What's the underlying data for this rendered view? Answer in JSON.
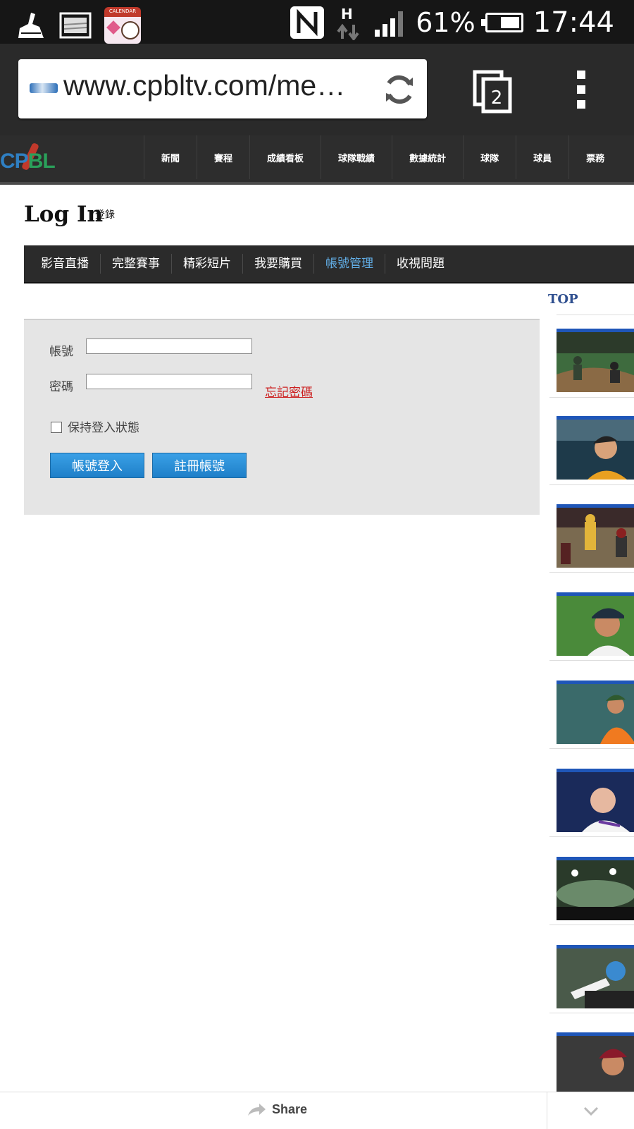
{
  "status_bar": {
    "battery_percent": "61%",
    "battery_level": 0.61,
    "time": "17:44",
    "network_type": "H",
    "calendar_app_label": "CALENDAR"
  },
  "browser": {
    "url": "www.cpbltv.com/membe…",
    "tab_count": "2"
  },
  "site_header": {
    "logo_left": "CP",
    "logo_right": "BL",
    "nav": [
      "新聞",
      "賽程",
      "成績看板",
      "球隊戰績",
      "數據統計",
      "球隊",
      "球員",
      "票務"
    ]
  },
  "page": {
    "title": "Log In",
    "subtitle": "登錄"
  },
  "subnav": {
    "items": [
      "影音直播",
      "完整賽事",
      "精彩短片",
      "我要購買",
      "帳號管理",
      "收視問題"
    ],
    "active_index": 4
  },
  "login": {
    "account_label": "帳號",
    "account_value": "",
    "password_label": "密碼",
    "password_value": "",
    "forgot_password": "忘記密碼",
    "remember_label": "保持登入狀態",
    "remember_checked": false,
    "login_button": "帳號登入",
    "register_button": "註冊帳號"
  },
  "sidebar": {
    "title": "TOP",
    "thumbnails": 9
  },
  "share_bar": {
    "share_label": "Share"
  },
  "colors": {
    "accent_blue": "#1e7fc8",
    "active_nav": "#62aee6",
    "forgot_red": "#cc1f1f",
    "sidebar_title": "#2f4f8f"
  }
}
